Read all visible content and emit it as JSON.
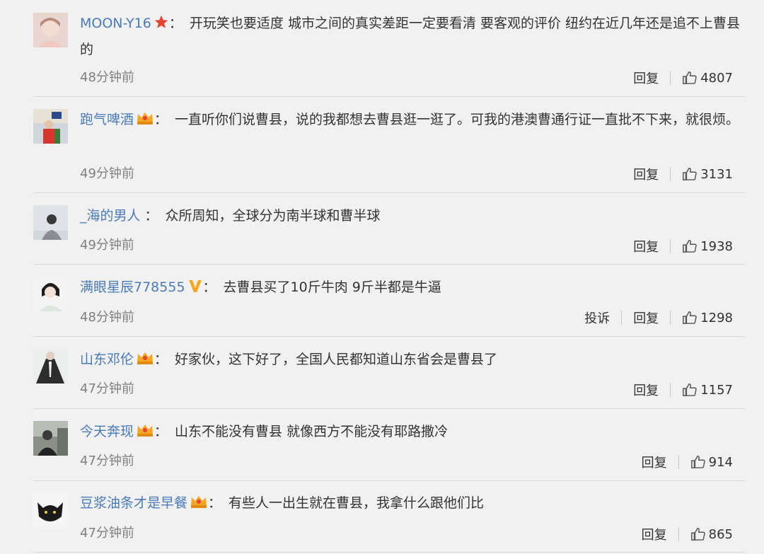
{
  "comments": [
    {
      "username": "MOON-Y16",
      "badge": "star",
      "text": "开玩笑也要适度 城市之间的真实差距一定要看清 要客观的评价 纽约在近几年还是追不上曹县的",
      "time": "48分钟前",
      "actions": [
        "回复"
      ],
      "likes": "4807"
    },
    {
      "username": "跑气啤酒",
      "badge": "crown",
      "text": "一直听你们说曹县，说的我都想去曹县逛一逛了。可我的港澳曹通行证一直批不下来，就很烦。",
      "time": "49分钟前",
      "actions": [
        "回复"
      ],
      "likes": "3131"
    },
    {
      "username": "_海的男人",
      "badge": "none",
      "text": "众所周知，全球分为南半球和曹半球",
      "time": "49分钟前",
      "actions": [
        "回复"
      ],
      "likes": "1938"
    },
    {
      "username": "满眼星辰778555",
      "badge": "v",
      "text": "去曹县买了10斤牛肉 9斤半都是牛逼",
      "time": "48分钟前",
      "actions": [
        "投诉",
        "回复"
      ],
      "likes": "1298"
    },
    {
      "username": "山东邓伦",
      "badge": "crown",
      "text": "好家伙，这下好了，全国人民都知道山东省会是曹县了",
      "time": "47分钟前",
      "actions": [
        "回复"
      ],
      "likes": "1157"
    },
    {
      "username": "今天奔现",
      "badge": "crown",
      "text": "山东不能没有曹县 就像西方不能没有耶路撒冷",
      "time": "47分钟前",
      "actions": [
        "回复"
      ],
      "likes": "914"
    },
    {
      "username": "豆浆油条才是早餐",
      "badge": "crown",
      "text": "有些人一出生就在曹县，我拿什么跟他们比",
      "time": "47分钟前",
      "actions": [
        "回复"
      ],
      "likes": "865"
    }
  ],
  "colon": "：",
  "colors": {
    "username": "#4a7bb8",
    "time": "#808080",
    "divider": "#d9d9d9",
    "background": "#f1f1f2"
  },
  "icons": {
    "like": "thumb-up-icon",
    "star": "star-badge-icon",
    "crown": "crown-badge-icon",
    "v": "v-badge-icon"
  }
}
